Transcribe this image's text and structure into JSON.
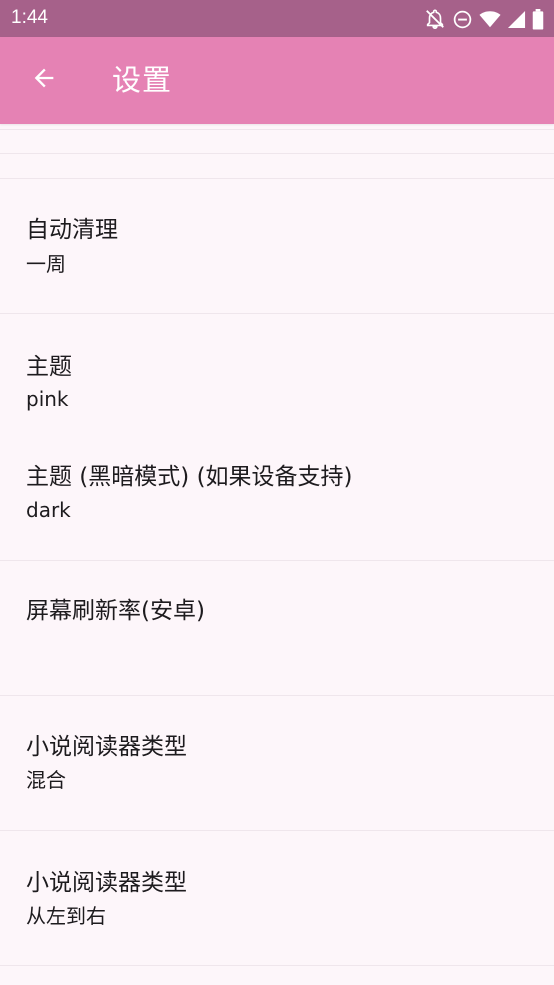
{
  "status_bar": {
    "time": "1:44",
    "icons": [
      "notifications-off-icon",
      "do-not-disturb-icon",
      "wifi-icon",
      "cellular-signal-icon",
      "battery-icon"
    ]
  },
  "app_bar": {
    "title": "设置",
    "back_icon": "arrow-back-icon",
    "color": "#e582b4"
  },
  "settings": [
    {
      "title": "自动清理",
      "value": "一周"
    },
    {
      "title": "主题",
      "value": "pink"
    },
    {
      "title": "主题 (黑暗模式) (如果设备支持)",
      "value": "dark"
    },
    {
      "title": "屏幕刷新率(安卓)",
      "value": ""
    },
    {
      "title": "小说阅读器类型",
      "value": "混合"
    },
    {
      "title": "小说阅读器类型",
      "value": "从左到右"
    }
  ],
  "colors": {
    "status_bar": "#a6618a",
    "background": "#fdf6fa",
    "text": "#1d1b1e"
  }
}
